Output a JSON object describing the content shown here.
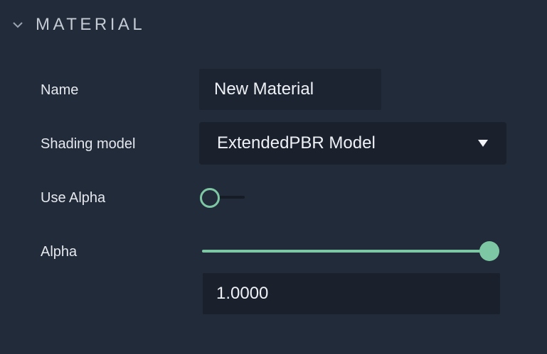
{
  "section": {
    "title": "MATERIAL",
    "collapse_icon": "chevron-down-icon"
  },
  "fields": {
    "name": {
      "label": "Name",
      "value": "New Material"
    },
    "shading_model": {
      "label": "Shading model",
      "value": "ExtendedPBR Model",
      "caret_icon": "triangle-down-icon"
    },
    "use_alpha": {
      "label": "Use Alpha",
      "checked": false
    },
    "alpha": {
      "label": "Alpha",
      "slider_fraction": 1.0,
      "value": "1.0000"
    }
  },
  "colors": {
    "background": "#222b3a",
    "field_background": "#1a202c",
    "accent": "#7ec7a4",
    "text": "#e6e9ee",
    "header_text": "#c5cbd4"
  }
}
